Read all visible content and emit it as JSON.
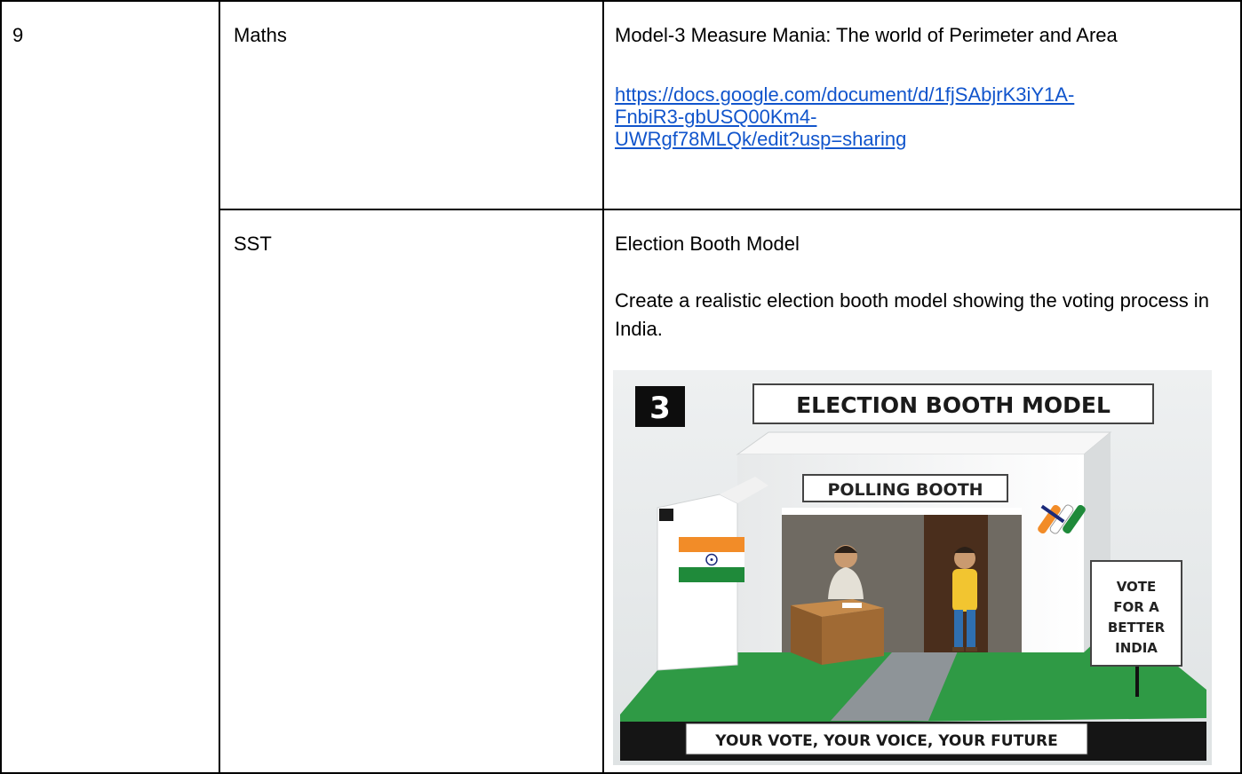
{
  "row_number": "9",
  "rows": [
    {
      "subject": "Maths",
      "title": "Model-3 Measure Mania: The world of Perimeter and Area",
      "link_lines": [
        "https://docs.google.com/document/d/1fjSAbjrK3iY1A-",
        "FnbiR3-gbUSQ00Km4-",
        "UWRgf78MLQk/edit?usp=sharing"
      ]
    },
    {
      "subject": "SST",
      "title": "Election Booth Model",
      "description": "Create a realistic election booth model showing the voting process in India.",
      "image": {
        "number_badge": "3",
        "banner": "ELECTION BOOTH MODEL",
        "booth_sign": "POLLING BOOTH",
        "side_sign_lines": [
          "VOTE",
          "FOR A",
          "BETTER",
          "INDIA"
        ],
        "base_slogan": "YOUR VOTE, YOUR VOICE, YOUR FUTURE"
      }
    }
  ],
  "colors": {
    "link": "#1155cc",
    "border": "#000000",
    "grass": "#2f9a45",
    "saffron": "#f28c28",
    "india_green": "#1f8a3a",
    "chakra_navy": "#1b2a7a"
  }
}
